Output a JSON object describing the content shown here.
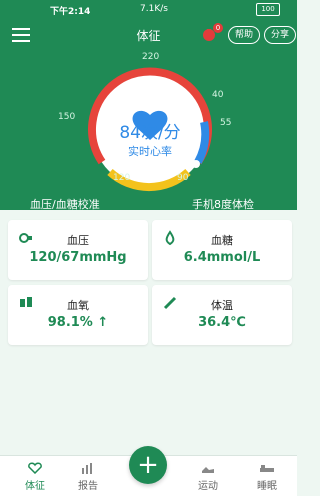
{
  "status_bar": {
    "time": "下午2:14",
    "network": "7.1K/s",
    "battery": "100"
  },
  "app_bar": {
    "title": "体征",
    "notification_count": "0",
    "help_label": "帮助",
    "share_label": "分享"
  },
  "gauge": {
    "value": "84次/分",
    "caption": "实时心率",
    "ticks": {
      "t220": "220",
      "t150": "150",
      "t120": "120",
      "t90": "90",
      "t55": "55",
      "t40": "40"
    },
    "colors": {
      "red": "#e6443b",
      "yellow": "#f3c21c",
      "blue": "#2f8ae6",
      "heart": "#2f8ae6"
    }
  },
  "links": {
    "bp_bg_calibrate": "血压/血糖校准",
    "phone_check": "手机8度体检"
  },
  "cards": {
    "bp": {
      "label": "血压",
      "value": "120/67mmHg"
    },
    "glucose": {
      "label": "血糖",
      "value": "6.4mmol/L"
    },
    "spo2": {
      "label": "血氧",
      "value": "98.1% ↑"
    },
    "temp": {
      "label": "体温",
      "value": "36.4℃"
    }
  },
  "nav": {
    "vitals": "体征",
    "report": "报告",
    "fab_label": "+",
    "sport": "运动",
    "sleep": "睡眠"
  }
}
